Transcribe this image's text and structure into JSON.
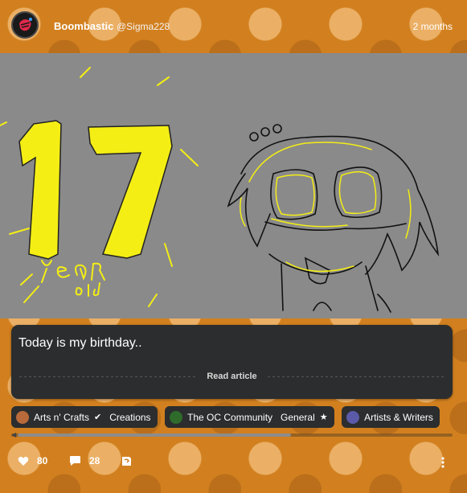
{
  "post": {
    "author": "Boombastic",
    "handle": "@Sigma228",
    "time": "2 months"
  },
  "image": {
    "number": "17",
    "caption_line1": "YeAR",
    "caption_line2": "old"
  },
  "card": {
    "title": "Today is my birthday..",
    "read_more": "Read article"
  },
  "tags": [
    {
      "name": "Arts n' Crafts",
      "sub": "Creations",
      "icon_color": "#b86a3a",
      "mark_icon": "verified-icon"
    },
    {
      "name": "The OC Community",
      "sub": "General",
      "icon_color": "#2f6b2a",
      "mark_icon": "star-icon"
    },
    {
      "name": "Artists & Writers",
      "sub": "",
      "icon_color": "#5a5aa8",
      "mark_icon": ""
    }
  ],
  "stats": {
    "likes": "80",
    "comments": "28"
  },
  "colors": {
    "accent_yellow": "#f4ee14",
    "card_bg": "#2b2d2e",
    "background_orange": "#d2801f"
  }
}
